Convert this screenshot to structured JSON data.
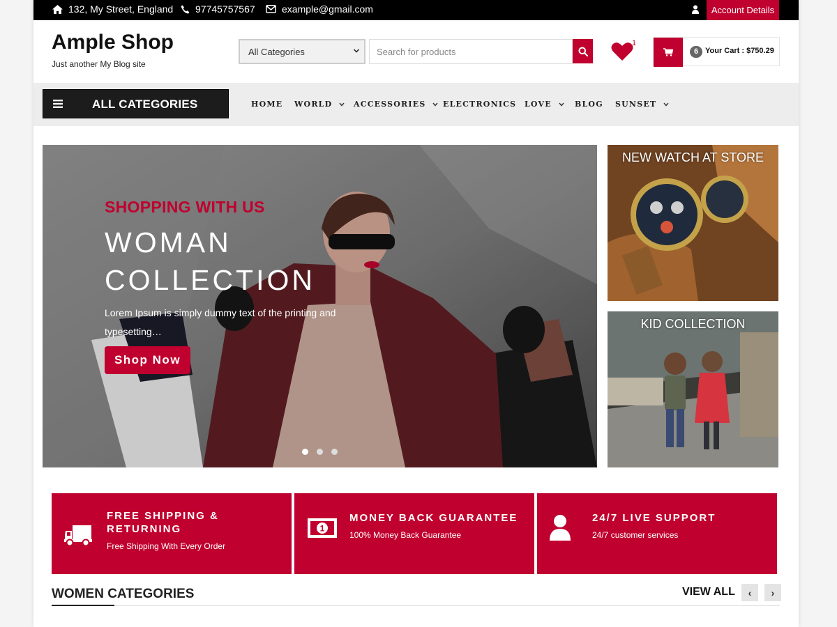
{
  "topbar": {
    "address": "132, My Street, England",
    "phone": "97745757567",
    "email": "example@gmail.com",
    "account_label": "Account Details"
  },
  "header": {
    "site_title": "Ample Shop",
    "tagline": "Just another My Blog site",
    "category_select": "All Categories",
    "search_placeholder": "Search for products",
    "wishlist_count": "1",
    "cart_count": "6",
    "cart_label": "Your Cart : $750.29"
  },
  "nav": {
    "all_categories": "ALL CATEGORIES",
    "items": [
      {
        "label": "HOME",
        "dropdown": false
      },
      {
        "label": "WORLD",
        "dropdown": true
      },
      {
        "label": "ACCESSORIES",
        "dropdown": true
      },
      {
        "label": "ELECTRONICS",
        "dropdown": false
      },
      {
        "label": "LOVE",
        "dropdown": true
      },
      {
        "label": "BLOG",
        "dropdown": false
      },
      {
        "label": "SUNSET",
        "dropdown": true
      }
    ]
  },
  "hero": {
    "subtitle": "SHOPPING WITH US",
    "title": "WOMAN COLLECTION",
    "text": "Lorem Ipsum is simply dummy text of the printing and typesetting…",
    "button": "Shop Now",
    "slides": 3,
    "active_slide": 1
  },
  "side_banners": [
    {
      "title": "NEW WATCH AT STORE"
    },
    {
      "title": "KID COLLECTION"
    }
  ],
  "features": [
    {
      "icon": "truck-icon",
      "title": "FREE SHIPPING & RETURNING",
      "text": "Free Shipping With Every Order"
    },
    {
      "icon": "money-icon",
      "title": "MONEY BACK GUARANTEE",
      "text": "100% Money Back Guarantee"
    },
    {
      "icon": "user-icon",
      "title": "24/7 LIVE SUPPORT",
      "text": "24/7 customer services"
    }
  ],
  "women_categories": {
    "title": "WOMEN CATEGORIES",
    "view_all": "VIEW ALL",
    "prev": "‹",
    "next": "›"
  },
  "colors": {
    "accent": "#c0002e",
    "topbar": "#000000",
    "nav_bg": "#ededed"
  }
}
